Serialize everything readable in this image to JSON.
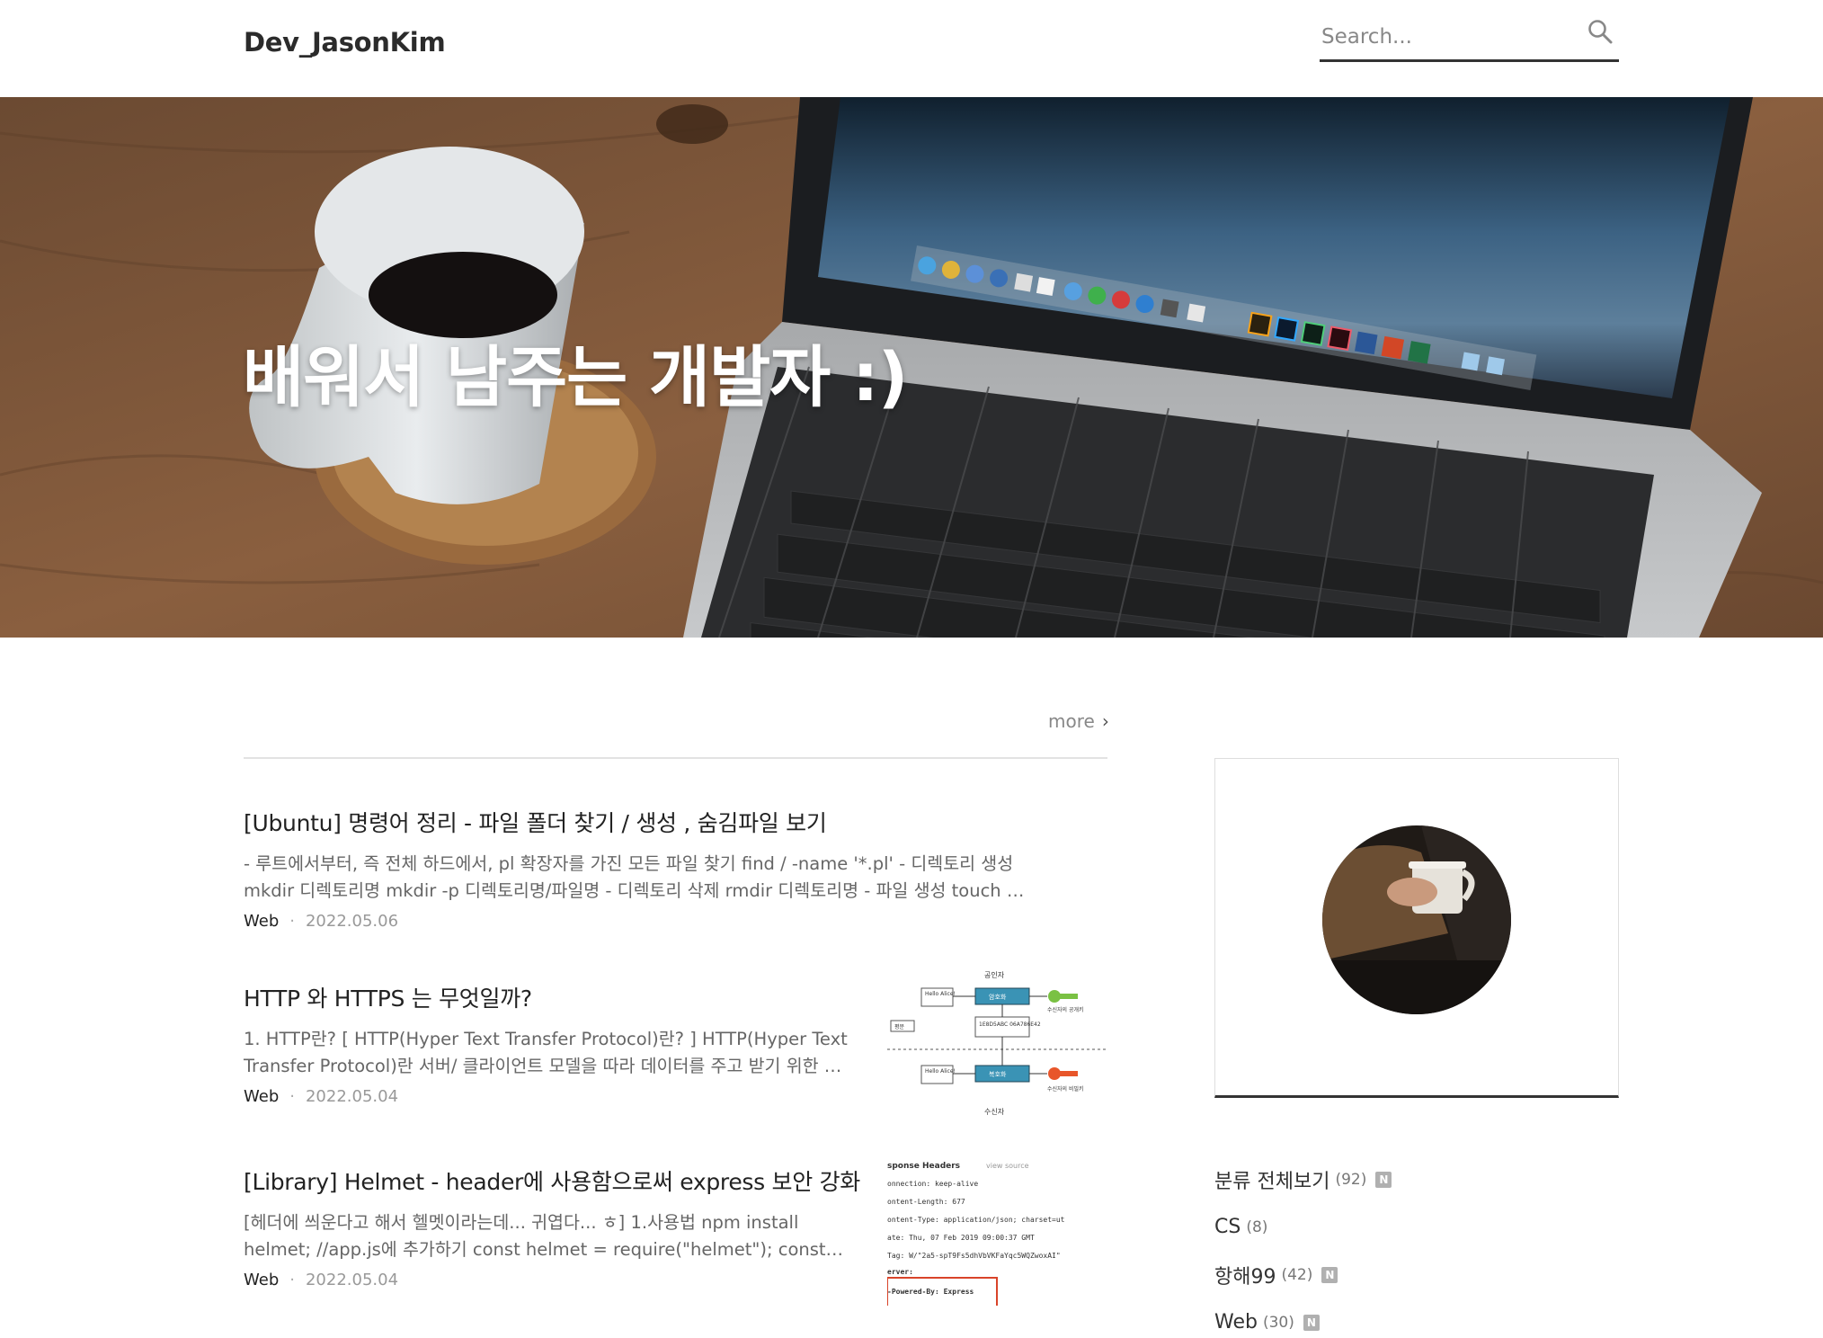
{
  "header": {
    "blog_title": "Dev_JasonKim",
    "search_placeholder": "Search..."
  },
  "hero": {
    "title": "배워서 남주는 개발자 :)"
  },
  "main": {
    "more_label": "more",
    "posts": [
      {
        "title": "[Ubuntu] 명령어 정리 - 파일 폴더 찾기 / 생성 , 숨김파일 보기",
        "excerpt": "- 루트에서부터, 즉 전체 하드에서, pl 확장자를 가진 모든 파일 찾기      find / -name '*.pl' - 디렉토리 생성      mkdir 디렉토리명      mkdir -p 디렉토리명/파일명 - 디렉토리 삭제      rmdir 디렉토리명 - 파일 생성    touch …",
        "category": "Web",
        "date": "2022.05.06"
      },
      {
        "title": "HTTP 와 HTTPS 는 무엇일까?",
        "excerpt": "1. HTTP란? [ HTTP(Hyper Text Transfer Protocol)란? ] HTTP(Hyper Text Transfer Protocol)란 서버/ 클라이언트 모델을 따라 데이터를 주고 받기 위한 …",
        "category": "Web",
        "date": "2022.05.04"
      },
      {
        "title": "[Library] Helmet - header에 사용함으로써 express 보안 강화",
        "excerpt": "[헤더에 씌운다고 해서 헬멧이라는데... 귀엽다... ㅎ] 1.사용법 npm install helmet; //app.js에 추가하기 const helmet = require(\"helmet\"); const…",
        "category": "Web",
        "date": "2022.05.04"
      }
    ],
    "thumb_http": {
      "top": "공인자",
      "box1": "Hello Alice!",
      "box2": "암호화",
      "box3": "1E8D5ABC 06A786E42",
      "box4": "Hello Alice!",
      "box5": "복호화",
      "key1": "수신자의 공개키",
      "key2": "수신자의 비밀키",
      "side": "평문",
      "bottom": "수신자"
    },
    "thumb_helmet": {
      "line1a": "sponse Headers",
      "line1b": "view source",
      "line2": "onnection: keep-alive",
      "line3": "ontent-Length: 677",
      "line4": "ontent-Type: application/json; charset=ut",
      "line5": "ate: Thu, 07 Feb 2019 09:00:37 GMT",
      "line6": "Tag: W/\"2a5-spT9Fs5dhVbVKFaYqc5WQZwoxAI\"",
      "line7": "erver:",
      "line8": "-Powered-By: Express"
    }
  },
  "sidebar": {
    "categories": [
      {
        "label": "분류 전체보기",
        "count": "(92)",
        "badge": "N"
      },
      {
        "label": "CS",
        "count": "(8)",
        "badge": ""
      },
      {
        "label": "항해99",
        "count": "(42)",
        "badge": "N"
      },
      {
        "label": "Web",
        "count": "(30)",
        "badge": "N"
      }
    ]
  },
  "colors": {
    "accent_dark": "#333333",
    "text_muted": "#888888",
    "badge_gray": "#b0b0b0",
    "key_green": "#7ac143",
    "key_red": "#e8562a",
    "box_teal": "#3a93b5",
    "highlight_red": "#d9442a"
  }
}
